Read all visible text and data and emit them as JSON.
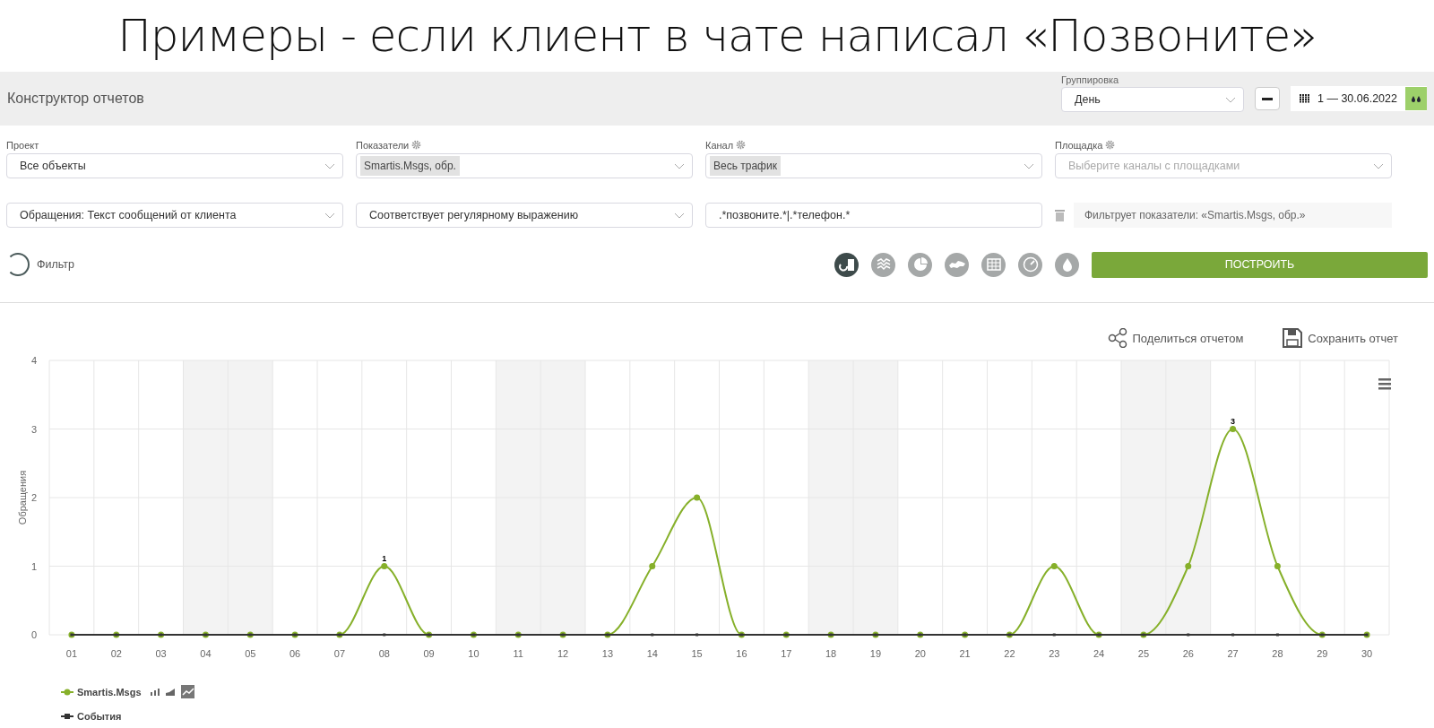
{
  "headline": "Примеры - если клиент в чате написал «Позвоните»",
  "header": {
    "title": "Конструктор отчетов",
    "grouping_label": "Группировка",
    "grouping_value": "День",
    "date_range": "1 — 30.06.2022"
  },
  "filters": [
    {
      "label": "Проект",
      "value": "Все объекты",
      "kind": "select",
      "gear": false
    },
    {
      "label": "Показатели",
      "value": "Smartis.Msgs, обр.",
      "kind": "tag",
      "gear": true
    },
    {
      "label": "Канал",
      "value": "Весь трафик",
      "kind": "tag",
      "gear": true
    },
    {
      "label": "Площадка",
      "placeholder": "Выберите каналы с площадками",
      "kind": "select",
      "gear": true
    }
  ],
  "condition": {
    "field": "Обращения: Текст сообщений от клиента",
    "operator": "Соответствует регулярному выражению",
    "value": ".*позвоните.*|.*телефон.*",
    "note": "Фильтрует показатели: «Smartis.Msgs, обр.»"
  },
  "filter_toggle": {
    "label": "Фильтр",
    "on": false
  },
  "chart_types": [
    {
      "kind": "combo",
      "selected": true
    },
    {
      "kind": "stacked",
      "selected": false
    },
    {
      "kind": "pie",
      "selected": false
    },
    {
      "kind": "map",
      "selected": false
    },
    {
      "kind": "table",
      "selected": false
    },
    {
      "kind": "gauge",
      "selected": false
    },
    {
      "kind": "drop",
      "selected": false
    }
  ],
  "build_button": "ПОСТРОИТЬ",
  "actions": [
    "Поделиться отчетом",
    "Сохранить отчет"
  ],
  "chart": {
    "chart_data": {
      "type": "line",
      "ylabel": "Обращения",
      "categories": [
        "01",
        "02",
        "03",
        "04",
        "05",
        "06",
        "07",
        "08",
        "09",
        "10",
        "11",
        "12",
        "13",
        "14",
        "15",
        "16",
        "17",
        "18",
        "19",
        "20",
        "21",
        "22",
        "23",
        "24",
        "25",
        "26",
        "27",
        "28",
        "29",
        "30"
      ],
      "grid": true,
      "series": [
        {
          "name": "Smartis.Msgs",
          "color": "#86b02a",
          "marker": true,
          "value_labels": [
            null,
            null,
            null,
            null,
            null,
            null,
            null,
            "1",
            null,
            null,
            null,
            null,
            null,
            null,
            null,
            null,
            null,
            null,
            null,
            null,
            null,
            null,
            null,
            null,
            null,
            null,
            "3",
            null,
            null,
            null
          ],
          "values": [
            0,
            0,
            0,
            0,
            0,
            0,
            0,
            1,
            0,
            0,
            0,
            0,
            0,
            1,
            2,
            0,
            0,
            0,
            0,
            0,
            0,
            0,
            1,
            0,
            0,
            1,
            3,
            1,
            0,
            0
          ]
        },
        {
          "name": "События",
          "color": "#333333",
          "marker": true,
          "values": [
            0,
            0,
            0,
            0,
            0,
            0,
            0,
            0,
            0,
            0,
            0,
            0,
            0,
            0,
            0,
            0,
            0,
            0,
            0,
            0,
            0,
            0,
            0,
            0,
            0,
            0,
            0,
            0,
            0,
            0
          ]
        }
      ],
      "ylim": [
        0,
        4
      ],
      "yticks": [
        0,
        1,
        2,
        3,
        4
      ]
    },
    "shaded_days": [
      false,
      false,
      false,
      true,
      true,
      false,
      false,
      false,
      false,
      false,
      true,
      true,
      false,
      false,
      false,
      false,
      false,
      true,
      true,
      false,
      false,
      false,
      false,
      false,
      true,
      true,
      false,
      false,
      false,
      false
    ]
  }
}
